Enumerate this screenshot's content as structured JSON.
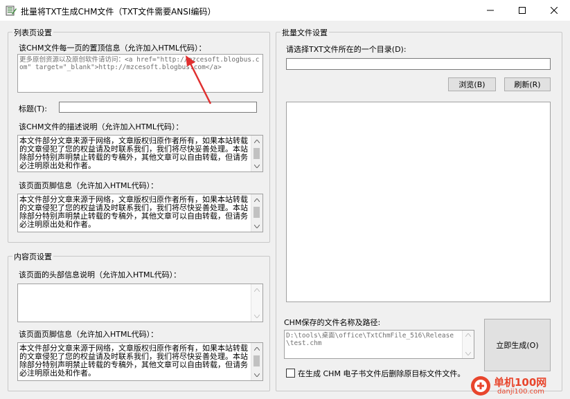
{
  "window": {
    "title": "批量将TXT生成CHM文件（TXT文件需要ANSI编码）"
  },
  "list_group": {
    "legend": "列表页设置",
    "top_info_label": "该CHM文件每一页的置顶信息（允许加入HTML代码）：",
    "top_info_value": "更多原创资源以及原创软件请访问：<a href=\"http://mzcesoft.blogbus.com\" target=\"_blank\">http://mzcesoft.blogbus.com</a>",
    "title_label": "标题(T):",
    "title_value": "",
    "desc_label": "该CHM文件的描述说明（允许加入HTML代码）：",
    "desc_value": "本文件部分文章来源于网络，文章版权归原作者所有，如果本站转载的文章侵犯了您的权益请及时联系我们，我们将尽快妥善处理。本站除部分特别声明禁止转载的专稿外，其他文章可以自由转载，但请务必注明原出处和作者。",
    "footer_label": "该页面页脚信息（允许加入HTML代码）：",
    "footer_value": "本文件部分文章来源于网络，文章版权归原作者所有，如果本站转载的文章侵犯了您的权益请及时联系我们，我们将尽快妥善处理。本站除部分特别声明禁止转载的专稿外，其他文章可以自由转载，但请务必注明原出处和作者。"
  },
  "content_group": {
    "legend": "内容页设置",
    "header_label": "该页面的头部信息说明（允许加入HTML代码）：",
    "header_value": "",
    "footer_label": "该页面页脚信息（允许加入HTML代码）：",
    "footer_value": "本文件部分文章来源于网络，文章版权归原作者所有，如果本站转载的文章侵犯了您的权益请及时联系我们，我们将尽快妥善处理。本站除部分特别声明禁止转载的专稿外，其他文章可以自由转载，但请务必注明原出处和作者。"
  },
  "batch_group": {
    "legend": "批量文件设置",
    "dir_label": "请选择TXT文件所在的一个目录(D):",
    "dir_value": "",
    "browse_button": "浏览(B)",
    "refresh_button": "刷新(R)",
    "save_path_label": "CHM保存的文件名称及路径:",
    "save_path_value": "D:\\tools\\桌面\\office\\TxtChmFile_516\\Release\\test.chm",
    "generate_button": "立即生成(O)",
    "delete_checkbox_label": "在生成 CHM 电子书文件后删除原目标文件文件。",
    "delete_checked": false
  },
  "watermark": {
    "name": "单机100网",
    "url": "danji100.com"
  },
  "colors": {
    "accent": "#0078d7",
    "arrow": "#e03030",
    "watermark": "#e8452c"
  }
}
